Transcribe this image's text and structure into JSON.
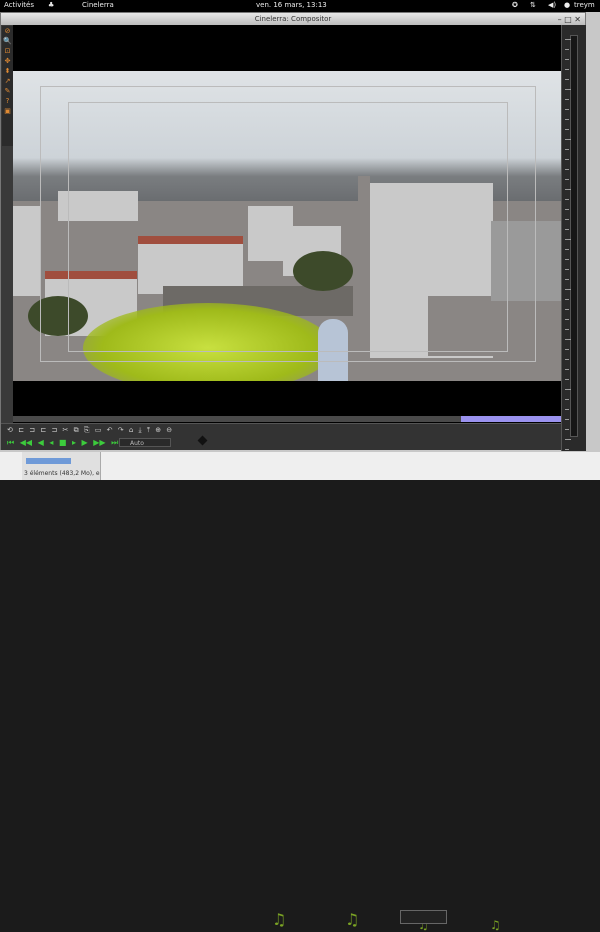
{
  "topbar": {
    "activities": "Activités",
    "app_name": "Cinelerra",
    "clock": "ven. 16 mars, 13:13",
    "user": "treym"
  },
  "window": {
    "title": "Cinelerra: Compositor",
    "minimize": "–",
    "maximize": "□",
    "close": "✕"
  },
  "left_tools": [
    "⊘",
    "🔍",
    "⊡",
    "✥",
    "⬍",
    "↗",
    "✎",
    "?",
    "▣"
  ],
  "transport": {
    "row1": [
      "⟲",
      "⊏",
      "⊐",
      "⊏",
      "⊐",
      "✂",
      "⧉",
      "⎘",
      "▭",
      "↶",
      "↷",
      "⌂",
      "⤓",
      "⤒",
      "⊕",
      "⊖"
    ],
    "row2": [
      "⏮",
      "◀◀",
      "◀",
      "◂",
      "■",
      "▸",
      "▶",
      "▶▶",
      "⏭"
    ]
  },
  "zoom": {
    "value": "Auto"
  },
  "file_manager": {
    "status": "3 éléments (483,2 Mo), e"
  },
  "colors": {
    "timeline_selection": "#9a92ee",
    "transport_icons": "#3ccc3c",
    "tool_icons": "#e08a33"
  }
}
